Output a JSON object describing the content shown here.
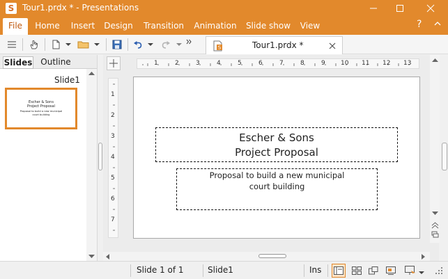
{
  "window": {
    "title": "Tour1.prdx * - Presentations",
    "app_icon_letter": "S"
  },
  "menu": {
    "tabs": [
      "File",
      "Home",
      "Insert",
      "Design",
      "Transition",
      "Animation",
      "Slide show",
      "View"
    ],
    "active_tab": "File",
    "help_label": "?"
  },
  "document_tab": {
    "label": "Tour1.prdx *"
  },
  "left_panel": {
    "tabs": [
      "Slides",
      "Outline"
    ],
    "active_tab": "Slides",
    "slide_label": "Slide1",
    "thumbnail": {
      "title_line1": "Escher & Sons",
      "title_line2": "Project Proposal",
      "subtitle_line1": "Proposal to build a new municipal",
      "subtitle_line2": "court building"
    }
  },
  "rulers": {
    "horizontal": [
      "1",
      "2",
      "3",
      "4",
      "5",
      "6",
      "7",
      "8",
      "9",
      "10",
      "11",
      "12",
      "13"
    ],
    "vertical": [
      "1",
      "2",
      "3",
      "4",
      "5",
      "6",
      "7"
    ]
  },
  "slide": {
    "title_line1": "Escher & Sons",
    "title_line2": "Project Proposal",
    "subtitle_line1": "Proposal to build a new municipal",
    "subtitle_line2": "court building"
  },
  "status": {
    "slide_count": "Slide 1 of 1",
    "slide_name": "Slide1",
    "mode": "Ins"
  },
  "colors": {
    "accent": "#e2892c"
  }
}
